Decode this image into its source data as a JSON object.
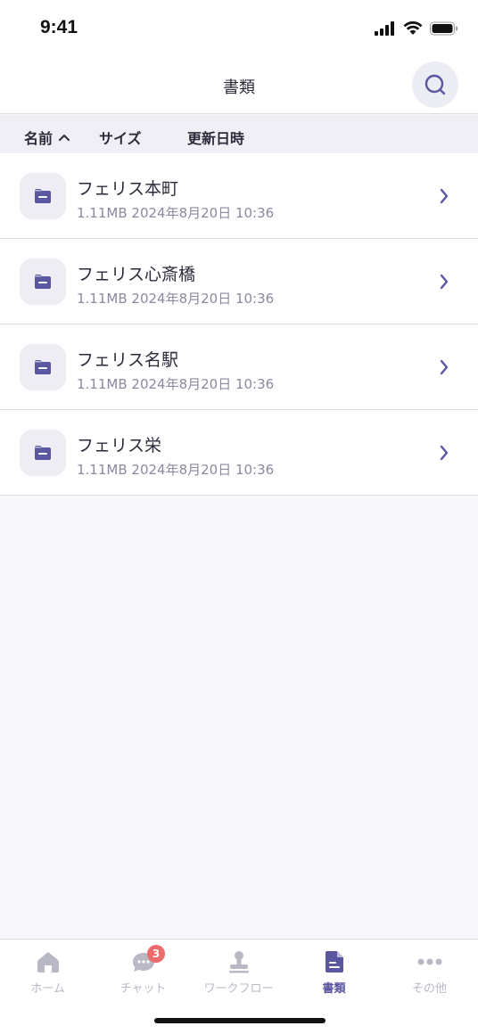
{
  "status": {
    "time": "9:41"
  },
  "header": {
    "title": "書類",
    "search_icon": "search-icon"
  },
  "sort_bar": {
    "name": "名前",
    "size": "サイズ",
    "updated": "更新日時"
  },
  "files": [
    {
      "name": "フェリス本町",
      "meta": "1.11MB 2024年8月20日 10:36"
    },
    {
      "name": "フェリス心斎橋",
      "meta": "1.11MB 2024年8月20日 10:36"
    },
    {
      "name": "フェリス名駅",
      "meta": "1.11MB 2024年8月20日 10:36"
    },
    {
      "name": "フェリス栄",
      "meta": "1.11MB 2024年8月20日 10:36"
    }
  ],
  "tabs": [
    {
      "label": "ホーム",
      "icon": "home-icon"
    },
    {
      "label": "チャット",
      "icon": "chat-icon",
      "badge": "3"
    },
    {
      "label": "ワークフロー",
      "icon": "stamp-icon"
    },
    {
      "label": "書類",
      "icon": "document-icon",
      "active": true
    },
    {
      "label": "その他",
      "icon": "more-icon"
    }
  ],
  "colors": {
    "accent": "#5b56a0",
    "badge": "#ec6b6b",
    "inactive": "#b9b9c6"
  }
}
